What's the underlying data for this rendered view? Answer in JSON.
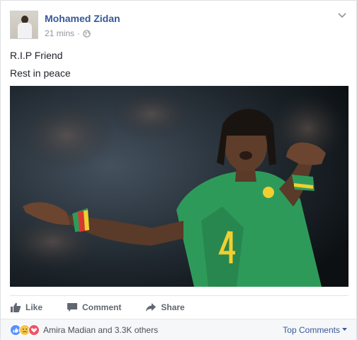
{
  "post": {
    "author": "Mohamed Zidan",
    "time": "21 mins",
    "separator": "·",
    "lines": [
      "R.I.P Friend",
      "Rest in peace"
    ]
  },
  "actions": {
    "like": "Like",
    "comment": "Comment",
    "share": "Share"
  },
  "reactions": {
    "icons": [
      "like-icon",
      "sad-icon",
      "love-icon"
    ],
    "summary": "Amira Madian and 3.3K others"
  },
  "sort": {
    "label": "Top Comments"
  },
  "colors": {
    "name": "#365899",
    "action_text": "#616770",
    "like": "#5890ff",
    "jersey": "#2e9a5a"
  }
}
